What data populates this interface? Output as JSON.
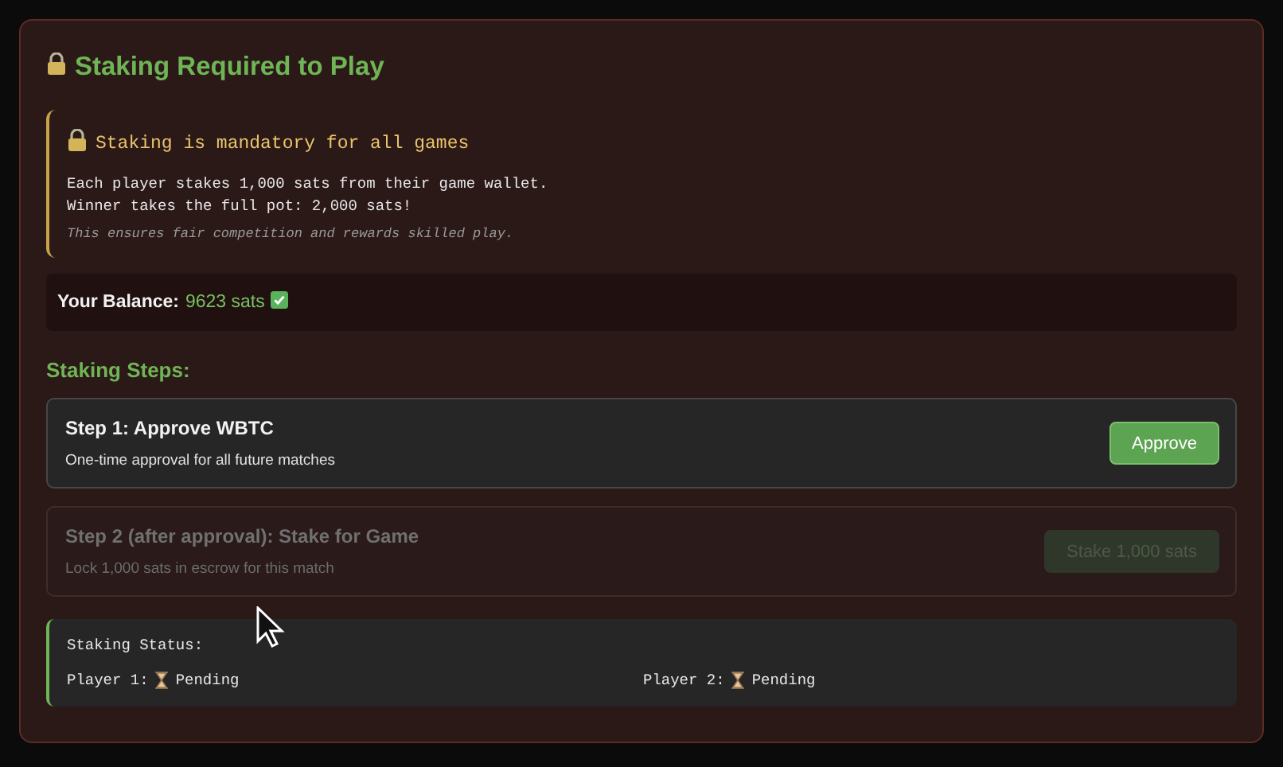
{
  "title": "Staking Required to Play",
  "notice": {
    "heading": "Staking is mandatory for all games",
    "lines": [
      "Each player stakes 1,000 sats from their game wallet.",
      "Winner takes the full pot: 2,000 sats!"
    ],
    "note": "This ensures fair competition and rewards skilled play."
  },
  "balance": {
    "label": "Your Balance:",
    "value": "9623 sats",
    "sufficient": true
  },
  "steps_heading": "Staking Steps:",
  "steps": [
    {
      "title": "Step 1: Approve WBTC",
      "description": "One-time approval for all future matches",
      "button": "Approve",
      "disabled": false
    },
    {
      "title": "Step 2 (after approval): Stake for Game",
      "description": "Lock 1,000 sats in escrow for this match",
      "button": "Stake 1,000 sats",
      "disabled": true
    }
  ],
  "status": {
    "heading": "Staking Status:",
    "players": [
      {
        "label": "Player 1:",
        "state": "Pending",
        "done": false
      },
      {
        "label": "Player 2:",
        "state": "Pending",
        "done": false
      }
    ]
  }
}
